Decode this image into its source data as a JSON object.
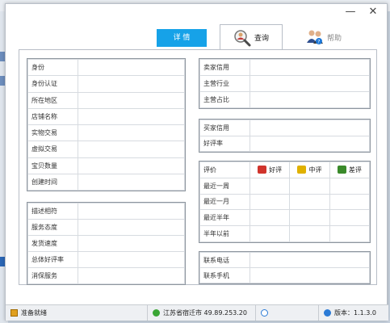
{
  "window": {
    "close_symbol": "✕",
    "minimize_symbol": "—"
  },
  "tabs": {
    "detail": "详 情",
    "query": "查询",
    "help": "帮助"
  },
  "seller_basic": {
    "rows": [
      "身份",
      "身份认证",
      "所在地区",
      "店铺名称",
      "实物交易",
      "虚拟交易",
      "宝贝数量",
      "创建时间"
    ]
  },
  "seller_service": {
    "rows": [
      "描述相符",
      "服务态度",
      "发货速度",
      "总体好评率",
      "消保服务"
    ]
  },
  "seller_credit": {
    "rows": [
      "卖家信用",
      "主营行业",
      "主营占比"
    ]
  },
  "buyer_credit": {
    "rows": [
      "买家信用",
      "好评率"
    ]
  },
  "ratings": {
    "header": "评价",
    "columns": [
      "好评",
      "中评",
      "差评"
    ],
    "rows": [
      "最近一周",
      "最近一月",
      "最近半年",
      "半年以前"
    ]
  },
  "contact": {
    "rows": [
      "联系电话",
      "联系手机"
    ]
  },
  "status": {
    "ready": "准备就绪",
    "location": "江苏省宿迁市 49.89.253.20",
    "version": "版本：1.1.3.0"
  },
  "colors": {
    "accent": "#16a2e8",
    "good": "#d0342c",
    "neutral": "#e0b100",
    "bad": "#3a8a2a"
  }
}
